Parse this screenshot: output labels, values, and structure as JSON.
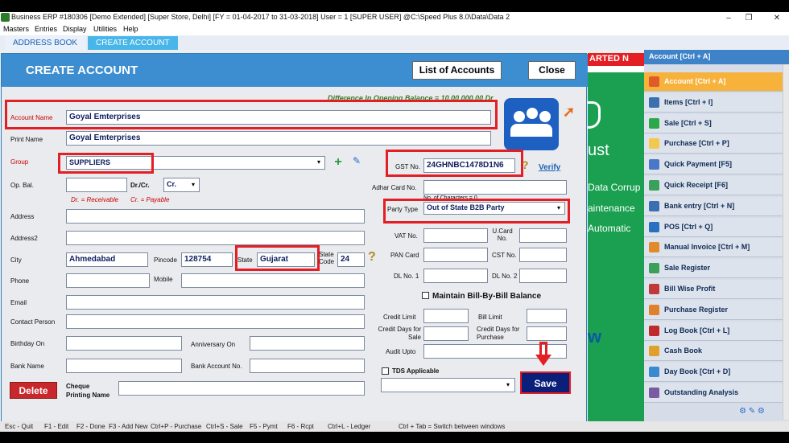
{
  "window": {
    "title": "Business ERP #180306 [Demo Extended]  [Super Store, Delhi] [FY = 01-04-2017 to 31-03-2018] User = 1 [SUPER USER]  @C:\\Speed Plus 8.0\\Data\\Data 2",
    "minimize": "–",
    "restore": "❐",
    "close": "✕"
  },
  "menu": [
    "Masters",
    "Entries",
    "Display",
    "Utilities",
    "Help"
  ],
  "tabs": [
    {
      "label": "ADDRESS BOOK"
    },
    {
      "label": "CREATE ACCOUNT"
    }
  ],
  "form": {
    "title": "CREATE ACCOUNT",
    "list_btn": "List of Accounts",
    "close_btn": "Close",
    "difference_text": "Difference In Opening Balance = 10,00,000.00 Dr",
    "account_name_label": "Account Name",
    "account_name": "Goyal Emterprises",
    "print_name_label": "Print Name",
    "print_name": "Goyal Emterprises",
    "group_label": "Group",
    "group": "SUPPLIERS",
    "gst_label": "GST No.",
    "gst": "24GHNBC1478D1N6",
    "verify": "Verify",
    "opbal_label": "Op. Bal.",
    "drcr_label": "Dr./Cr.",
    "drcr": "Cr.",
    "dr_note": "Dr. = Receivable",
    "cr_note": "Cr. = Payable",
    "aadhar_label": "Adhar Card No.",
    "chars_note": "No. of Characters = 0",
    "party_type_label": "Party Type",
    "party_type": "Out of State B2B Party",
    "address_label": "Address",
    "address2_label": "Address2",
    "vat_label": "VAT No.",
    "ucard_label": "U.Card No.",
    "city_label": "City",
    "city": "Ahmedabad",
    "pincode_label": "Pincode",
    "pincode": "128754",
    "state_label": "State",
    "state": "Gujarat",
    "state_code_label": "State Code",
    "state_code": "24",
    "pan_label": "PAN Card",
    "cst_label": "CST No.",
    "phone_label": "Phone",
    "mobile_label": "Mobile",
    "dl1_label": "DL No. 1",
    "dl2_label": "DL No. 2",
    "email_label": "Email",
    "maintain_label": "Maintain Bill-By-Bill Balance",
    "contact_label": "Contact Person",
    "credit_limit_label": "Credit Limit",
    "bill_limit_label": "Bill Limit",
    "birthday_label": "Birthday On",
    "anniversary_label": "Anniversary On",
    "credit_days_sale_label": "Credit Days for Sale",
    "credit_days_purchase_label": "Credit Days for Purchase",
    "audit_label": "Audit Upto",
    "bank_name_label": "Bank Name",
    "bank_account_label": "Bank Account No.",
    "tds_label": "TDS Applicable",
    "delete_btn": "Delete",
    "cheque_label": "Cheque Printing Name",
    "save_btn": "Save"
  },
  "promo": {
    "banner": "ARTED N",
    "line1": "ust",
    "line2": "Data Corrup",
    "line3": "aintenance",
    "line4": "Automatic",
    "line5": "w"
  },
  "right_panel": {
    "header": "Account [Ctrl + A]",
    "items": [
      {
        "label": "Account [Ctrl + A]",
        "color": "#e05a2a"
      },
      {
        "label": "Items [Ctrl + I]",
        "color": "#3a6fb0"
      },
      {
        "label": "Sale [Ctrl + S]",
        "color": "#2aa84a"
      },
      {
        "label": "Purchase [Ctrl + P]",
        "color": "#f2c94c"
      },
      {
        "label": "Quick Payment [F5]",
        "color": "#4a78c8"
      },
      {
        "label": "Quick Receipt [F6]",
        "color": "#3aa05a"
      },
      {
        "label": "Bank entry [Ctrl + N]",
        "color": "#3a6fb0"
      },
      {
        "label": "POS [Ctrl + Q]",
        "color": "#2a70c0"
      },
      {
        "label": "Manual Invoice [Ctrl + M]",
        "color": "#e08a2a"
      },
      {
        "label": "Sale Register",
        "color": "#3aa05a"
      },
      {
        "label": "Bill Wise Profit",
        "color": "#c03a3a"
      },
      {
        "label": "Purchase Register",
        "color": "#e0802a"
      },
      {
        "label": "Log Book [Ctrl + L]",
        "color": "#c02a2a"
      },
      {
        "label": "Cash Book",
        "color": "#e0a02a"
      },
      {
        "label": "Day Book [Ctrl + D]",
        "color": "#3a8ad0"
      },
      {
        "label": "Outstanding Analysis",
        "color": "#7a5aa0"
      }
    ]
  },
  "statusbar": [
    "Esc - Quit",
    "F1 - Edit",
    "F2 - Done",
    "F3 - Add New",
    "Ctrl+P - Purchase",
    "Ctrl+S - Sale",
    "F5 - Pymt",
    "F6 - Rcpt",
    "Ctrl+L - Ledger",
    "Ctrl + Tab = Switch between windows"
  ]
}
